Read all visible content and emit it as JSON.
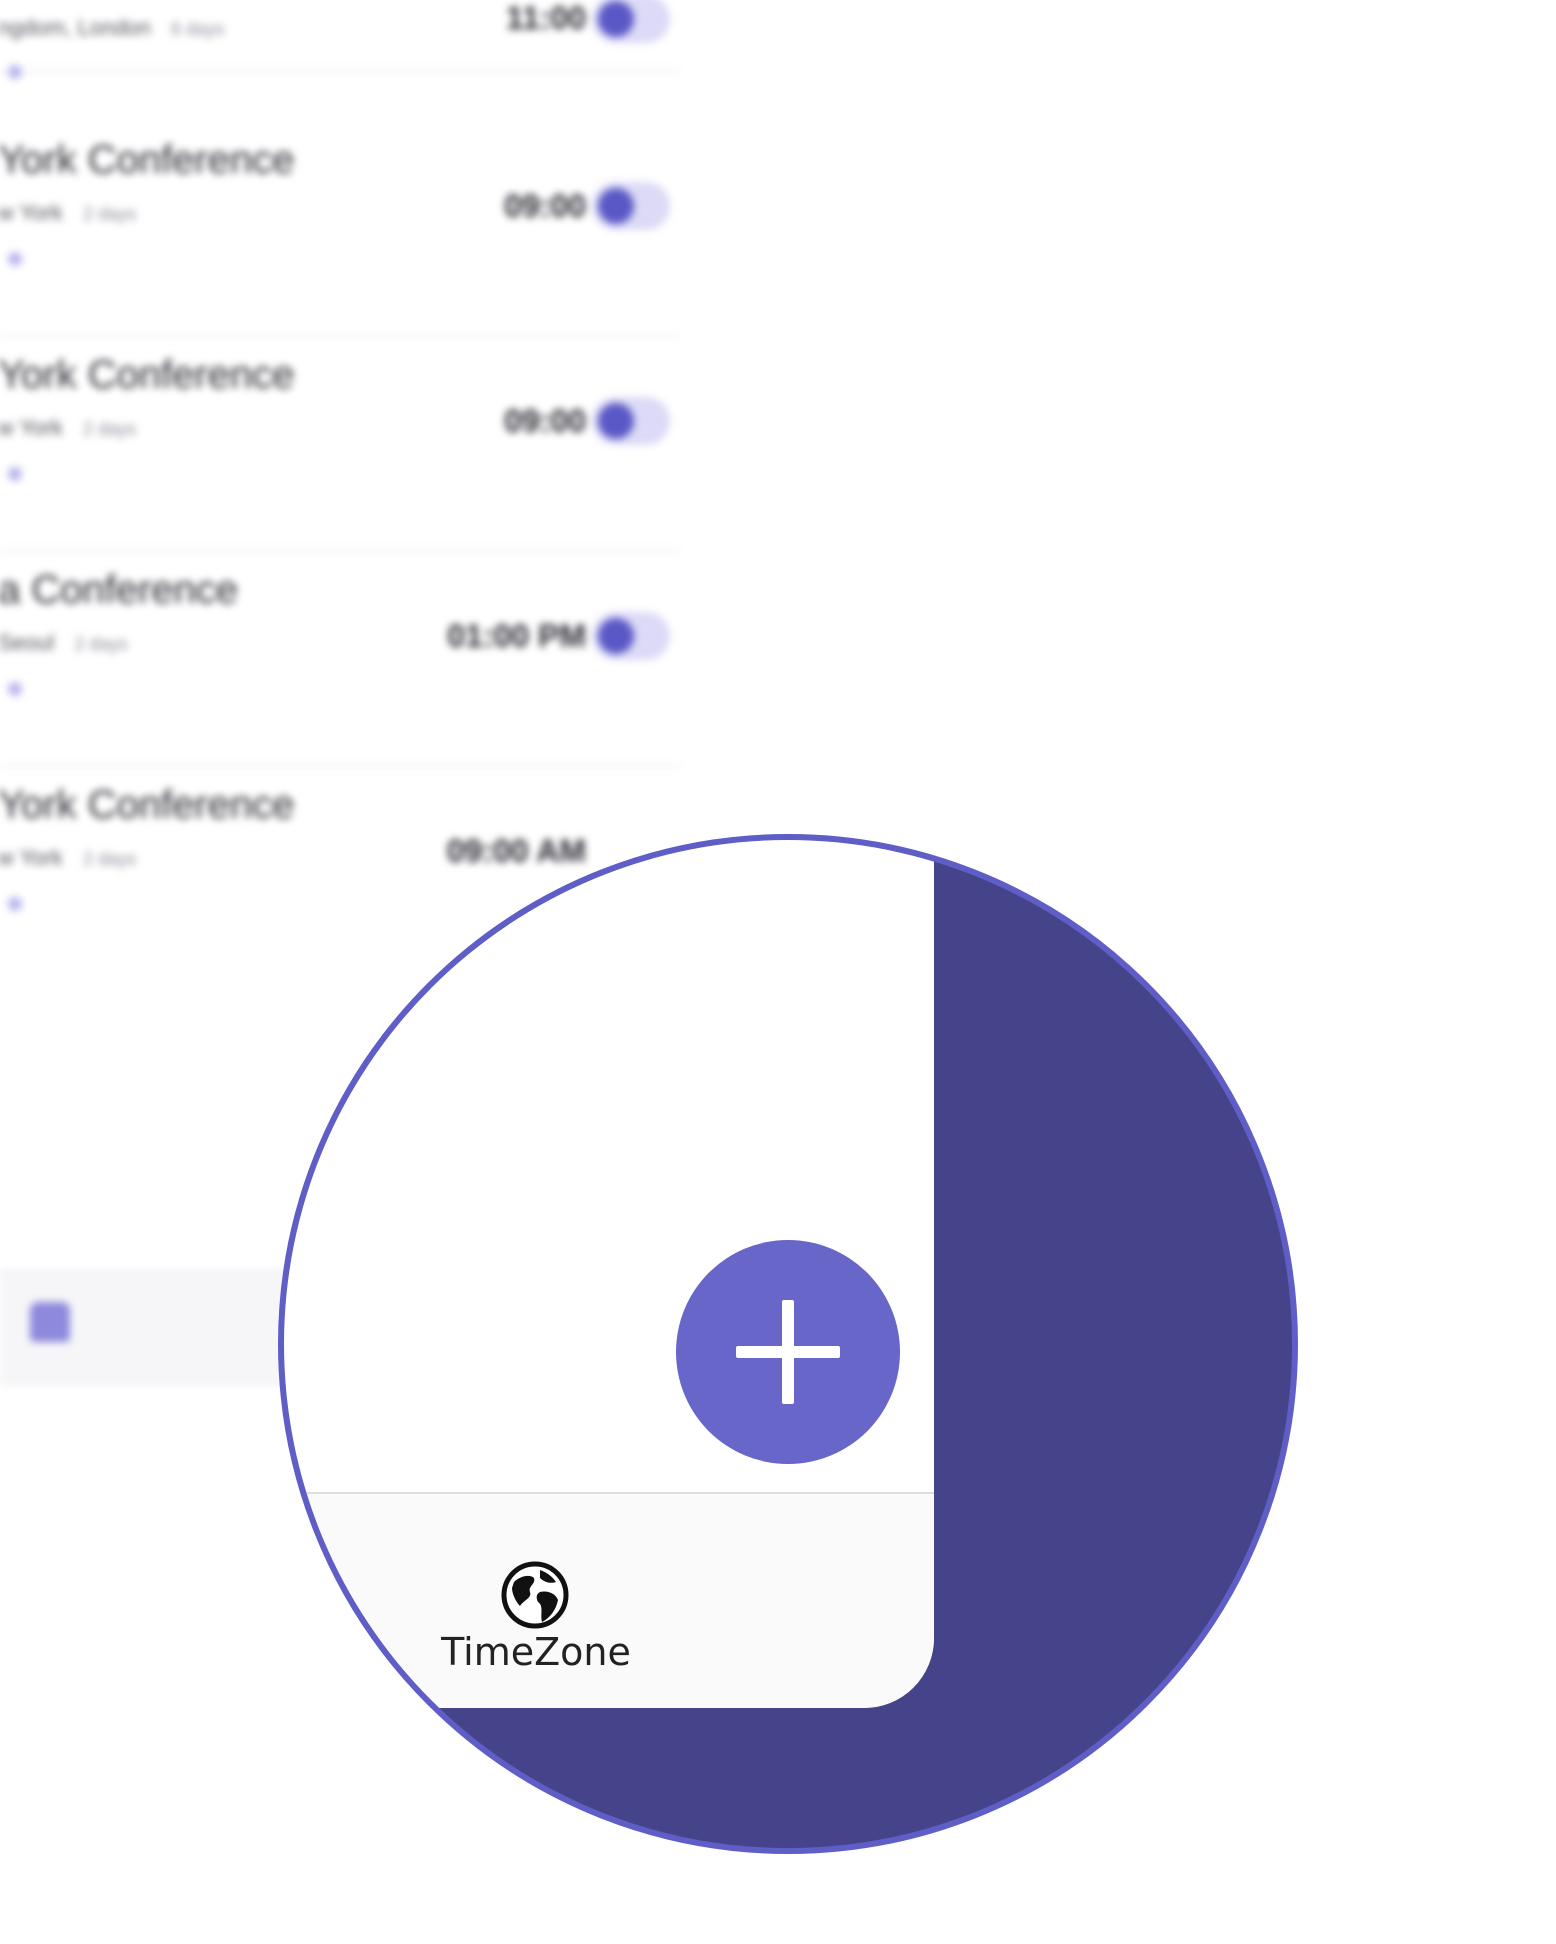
{
  "background_list": {
    "items": [
      {
        "title": "ngdom, London",
        "location": "",
        "days": "6 days",
        "time": "11:00",
        "toggle_on": true
      },
      {
        "title": "York Conference",
        "location": "w York",
        "days": "2 days",
        "time": "09:00",
        "toggle_on": true
      },
      {
        "title": "York Conference",
        "location": "w York",
        "days": "2 days",
        "time": "09:00",
        "toggle_on": true
      },
      {
        "title": "a Conference",
        "location": "Seoul",
        "days": "2 days",
        "time": "01:00 PM",
        "toggle_on": true
      },
      {
        "title": "York Conference",
        "location": "w York",
        "days": "2 days",
        "time": "09:00 AM",
        "toggle_on": true
      }
    ]
  },
  "fab": {
    "icon": "plus-icon",
    "color": "#6866c8"
  },
  "tabbar": {
    "timezone": {
      "icon": "globe-icon",
      "label": "TimeZone"
    }
  },
  "colors": {
    "accent": "#6866c8",
    "magnifier_backdrop": "#45448a",
    "magnifier_ring": "#5f5dc6"
  }
}
